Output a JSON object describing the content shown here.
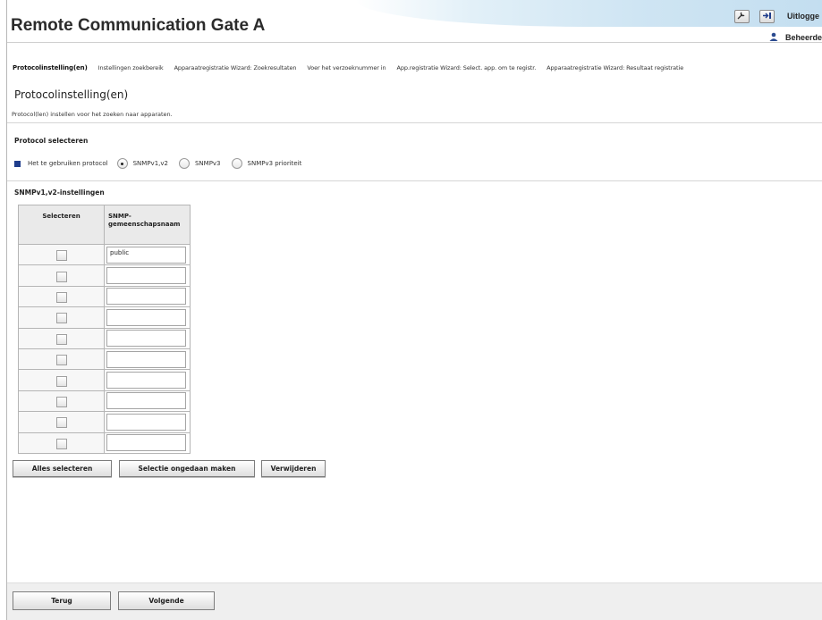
{
  "app": {
    "title": "Remote Communication Gate A",
    "logout_label": "Uitlogge",
    "user_label": "Beheerde"
  },
  "breadcrumb": [
    "Protocolinstelling(en)",
    "Instellingen zoekbereik",
    "Apparaatregistratie Wizard: Zoekresultaten",
    "Voer het verzoeknummer in",
    "App.registratie Wizard: Select. app. om te registr.",
    "Apparaatregistratie Wizard: Resultaat registratie"
  ],
  "page": {
    "title": "Protocolinstelling(en)",
    "description": "Protocol(len) instellen voor het zoeken naar apparaten."
  },
  "protocol": {
    "section_title": "Protocol selecteren",
    "label": "Het te gebruiken protocol",
    "options": [
      "SNMPv1,v2",
      "SNMPv3",
      "SNMPv3 prioriteit"
    ],
    "selected": "SNMPv1,v2"
  },
  "snmp": {
    "section_title": "SNMPv1,v2-instellingen",
    "col_select": "Selecteren",
    "col_community": "SNMP-gemeenschapsnaam",
    "rows": [
      "public",
      "",
      "",
      "",
      "",
      "",
      "",
      "",
      "",
      ""
    ]
  },
  "actions": {
    "select_all": "Alles selecteren",
    "deselect": "Selectie ongedaan maken",
    "delete": "Verwijderen"
  },
  "footer": {
    "back": "Terug",
    "next": "Volgende"
  },
  "colors": {
    "accent_square": "#1f3d8c",
    "header_gradient": "#cfe5f3"
  },
  "icons": {
    "tool": "wrench-icon",
    "logout": "logout-icon",
    "user": "user-icon"
  }
}
